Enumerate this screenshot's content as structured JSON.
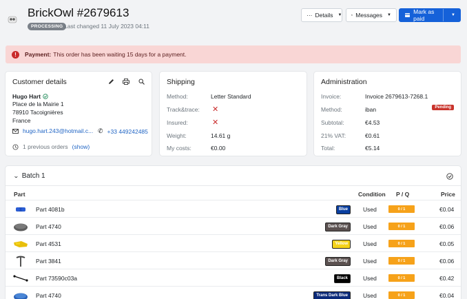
{
  "header": {
    "title": "BrickOwl #2679613",
    "status": "PROCESSING",
    "last_changed": "Last changed 11 July 2023 04:11",
    "details_label": "Details",
    "messages_label": "Messages",
    "mark_paid_label": "Mark as paid"
  },
  "alert": {
    "label": "Payment:",
    "text": "This order has been waiting 15 days for a payment."
  },
  "customer": {
    "title": "Customer details",
    "name": "Hugo Hart",
    "address": [
      "Place de la Mairie 1",
      "78910 Tacoignières",
      "France"
    ],
    "email": "hugo.hart.243@hotmail.c...",
    "phone": "+33 449242485",
    "previous_orders": "1 previous orders",
    "show_label": "(show)"
  },
  "shipping": {
    "title": "Shipping",
    "rows": [
      {
        "label": "Method:",
        "value": "Letter Standard"
      },
      {
        "label": "Track&trace:",
        "value": "✕"
      },
      {
        "label": "Insured:",
        "value": "✕"
      },
      {
        "label": "Weight:",
        "value": "14.61 g"
      },
      {
        "label": "My costs:",
        "value": "€0.00"
      }
    ]
  },
  "administration": {
    "title": "Administration",
    "invoice_label": "Invoice:",
    "invoice_value": "Invoice 2679613-7268.1",
    "method_label": "Method:",
    "method_value": "iban",
    "pending_badge": "Pending",
    "subtotal_label": "Subtotal:",
    "subtotal_value": "€4.53",
    "vat_label": "21% VAT:",
    "vat_value": "€0.61",
    "total_label": "Total:",
    "total_value": "€5.14"
  },
  "batch": {
    "title": "Batch 1",
    "columns": {
      "part": "Part",
      "condition": "Condition",
      "pq": "P / Q",
      "price": "Price"
    },
    "rows": [
      {
        "part": "Part 4081b",
        "color": "Blue",
        "color_bg": "#0a3fa0",
        "color_fg": "#ffffff",
        "condition": "Used",
        "pq": "0 / 1",
        "price": "€0.04",
        "thumb": "blue-clip"
      },
      {
        "part": "Part 4740",
        "color": "Dark Gray",
        "color_bg": "#5b5150",
        "color_fg": "#ffffff",
        "condition": "Used",
        "pq": "0 / 1",
        "price": "€0.06",
        "thumb": "gray-dish"
      },
      {
        "part": "Part 4531",
        "color": "Yellow",
        "color_bg": "#f5d31a",
        "color_fg": "#ffffff",
        "condition": "Used",
        "pq": "0 / 1",
        "price": "€0.05",
        "thumb": "yellow-hinge"
      },
      {
        "part": "Part 3841",
        "color": "Dark Gray",
        "color_bg": "#5b5150",
        "color_fg": "#ffffff",
        "condition": "Used",
        "pq": "0 / 1",
        "price": "€0.06",
        "thumb": "gray-pickaxe"
      },
      {
        "part": "Part 73590c03a",
        "color": "Black",
        "color_bg": "#000000",
        "color_fg": "#ffffff",
        "condition": "Used",
        "pq": "0 / 1",
        "price": "€0.42",
        "thumb": "black-hose"
      },
      {
        "part": "Part 4740",
        "color": "Trans Dark Blue",
        "color_bg": "#0b2a7a",
        "color_fg": "#ffffff",
        "condition": "Used",
        "pq": "0 / 1",
        "price": "€0.04",
        "thumb": "blue-dish"
      }
    ]
  }
}
